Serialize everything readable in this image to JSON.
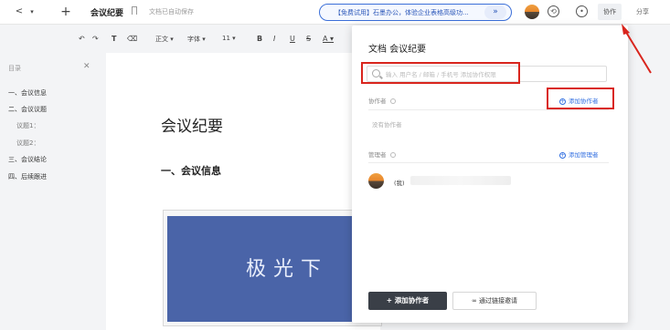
{
  "nav": {
    "back": "<",
    "back_dropdown": "▾",
    "new": "+"
  },
  "header": {
    "doc_title": "会议纪要",
    "autosave": "文档已自动保存",
    "promo": "【免费试用】石墨办公，体验企业表格高级功...",
    "promo_more": "»",
    "tab_collab": "协作",
    "tab_share": "分享"
  },
  "toolbar": {
    "undo": "↶",
    "redo": "↷",
    "format_paint": "T",
    "clear_format": "⌫",
    "paragraph": "正文 ▾",
    "font": "字体 ▾",
    "size": "11 ▾",
    "bold": "B",
    "italic": "I",
    "underline": "U",
    "strike": "S",
    "font_color": "A ▾"
  },
  "outline": {
    "title": "目录",
    "close": "✕",
    "items": [
      {
        "label": "一、会议信息",
        "sub": false
      },
      {
        "label": "二、会议议题",
        "sub": false
      },
      {
        "label": "议题1：",
        "sub": true
      },
      {
        "label": "议题2：",
        "sub": true
      },
      {
        "label": "三、会议结论",
        "sub": false
      },
      {
        "label": "四、后续跟进",
        "sub": false
      }
    ]
  },
  "document": {
    "heading1": "会议纪要",
    "heading2": "一、会议信息",
    "slide_text": "极光下"
  },
  "panel": {
    "title": "文档 会议纪要",
    "search_placeholder": "输入 用户名 / 邮箱 / 手机号 添加协作权限",
    "collaborators_label": "协作者",
    "add_collaborator_link": "添加协作者",
    "empty_collaborators": "没有协作者",
    "admins_label": "管理者",
    "add_admin_link": "添加管理者",
    "admin_me": "(我)",
    "add_button": "+ 添加协作者",
    "link_invite_button": "通过链接邀请"
  },
  "colors": {
    "accent": "#2f6de0",
    "annotation_red": "#d9251d",
    "slide_blue": "#4a64a8",
    "primary_button": "#3a3f47"
  }
}
